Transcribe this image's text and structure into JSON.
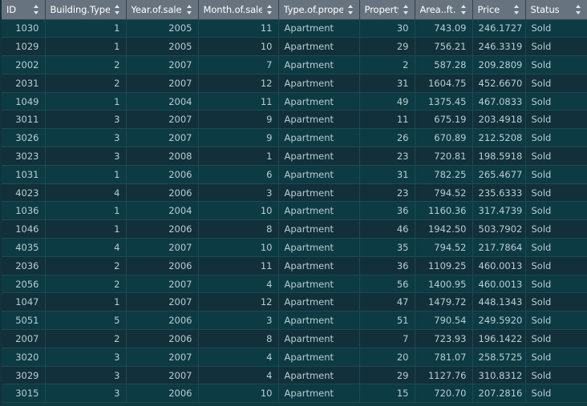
{
  "table": {
    "columns": [
      {
        "key": "id",
        "label": "ID",
        "align": "num",
        "sortable": true
      },
      {
        "key": "btype",
        "label": "Building.Type",
        "align": "num",
        "sortable": true
      },
      {
        "key": "year",
        "label": "Year.of.sale",
        "align": "num",
        "sortable": true
      },
      {
        "key": "month",
        "label": "Month.of.sale",
        "align": "num",
        "sortable": true
      },
      {
        "key": "ptype",
        "label": "Type.of.property",
        "align": "txt",
        "sortable": true
      },
      {
        "key": "prop",
        "label": "Property..",
        "align": "num",
        "sortable": true
      },
      {
        "key": "area",
        "label": "Area..ft..",
        "align": "num",
        "sortable": true
      },
      {
        "key": "price",
        "label": "Price",
        "align": "num",
        "sortable": true
      },
      {
        "key": "status",
        "label": "Status",
        "align": "txt",
        "sortable": true
      }
    ],
    "rows": [
      [
        "1030",
        "1",
        "2005",
        "11",
        "Apartment",
        "30",
        "743.09",
        "246.1727",
        "Sold"
      ],
      [
        "1029",
        "1",
        "2005",
        "10",
        "Apartment",
        "29",
        "756.21",
        "246.3319",
        "Sold"
      ],
      [
        "2002",
        "2",
        "2007",
        "7",
        "Apartment",
        "2",
        "587.28",
        "209.2809",
        "Sold"
      ],
      [
        "2031",
        "2",
        "2007",
        "12",
        "Apartment",
        "31",
        "1604.75",
        "452.6670",
        "Sold"
      ],
      [
        "1049",
        "1",
        "2004",
        "11",
        "Apartment",
        "49",
        "1375.45",
        "467.0833",
        "Sold"
      ],
      [
        "3011",
        "3",
        "2007",
        "9",
        "Apartment",
        "11",
        "675.19",
        "203.4918",
        "Sold"
      ],
      [
        "3026",
        "3",
        "2007",
        "9",
        "Apartment",
        "26",
        "670.89",
        "212.5208",
        "Sold"
      ],
      [
        "3023",
        "3",
        "2008",
        "1",
        "Apartment",
        "23",
        "720.81",
        "198.5918",
        "Sold"
      ],
      [
        "1031",
        "1",
        "2006",
        "6",
        "Apartment",
        "31",
        "782.25",
        "265.4677",
        "Sold"
      ],
      [
        "4023",
        "4",
        "2006",
        "3",
        "Apartment",
        "23",
        "794.52",
        "235.6333",
        "Sold"
      ],
      [
        "1036",
        "1",
        "2004",
        "10",
        "Apartment",
        "36",
        "1160.36",
        "317.4739",
        "Sold"
      ],
      [
        "1046",
        "1",
        "2006",
        "8",
        "Apartment",
        "46",
        "1942.50",
        "503.7902",
        "Sold"
      ],
      [
        "4035",
        "4",
        "2007",
        "10",
        "Apartment",
        "35",
        "794.52",
        "217.7864",
        "Sold"
      ],
      [
        "2036",
        "2",
        "2006",
        "11",
        "Apartment",
        "36",
        "1109.25",
        "460.0013",
        "Sold"
      ],
      [
        "2056",
        "2",
        "2007",
        "4",
        "Apartment",
        "56",
        "1400.95",
        "460.0013",
        "Sold"
      ],
      [
        "1047",
        "1",
        "2007",
        "12",
        "Apartment",
        "47",
        "1479.72",
        "448.1343",
        "Sold"
      ],
      [
        "5051",
        "5",
        "2006",
        "3",
        "Apartment",
        "51",
        "790.54",
        "249.5920",
        "Sold"
      ],
      [
        "2007",
        "2",
        "2006",
        "8",
        "Apartment",
        "7",
        "723.93",
        "196.1422",
        "Sold"
      ],
      [
        "3020",
        "3",
        "2007",
        "4",
        "Apartment",
        "20",
        "781.07",
        "258.5725",
        "Sold"
      ],
      [
        "3029",
        "3",
        "2007",
        "4",
        "Apartment",
        "29",
        "1127.76",
        "310.8312",
        "Sold"
      ],
      [
        "3015",
        "3",
        "2006",
        "10",
        "Apartment",
        "15",
        "720.70",
        "207.2816",
        "Sold"
      ]
    ]
  },
  "theme": {
    "header_bg": "#67747f",
    "header_text": "#ffffff",
    "row_even_bg": "#0d3b44",
    "row_odd_bg": "#113039",
    "cell_text": "#b9cdd2",
    "gridline": "#1d4952",
    "canvas_bg": "#13333a"
  },
  "icons": {
    "sort": "sort-updown-icon"
  }
}
